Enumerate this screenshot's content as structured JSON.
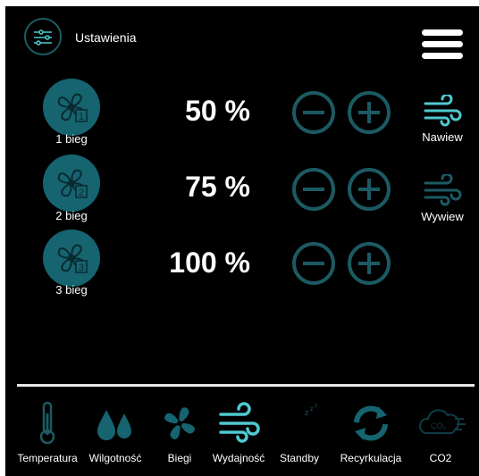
{
  "header": {
    "title": "Ustawienia",
    "settings_icon": "sliders-icon",
    "menu_icon": "hamburger-menu-icon"
  },
  "speeds": [
    {
      "label": "1 bieg",
      "value": "50 %",
      "badge": "1"
    },
    {
      "label": "2 bieg",
      "value": "75 %",
      "badge": "2"
    },
    {
      "label": "3 bieg",
      "value": "100 %",
      "badge": "3"
    }
  ],
  "airflow": {
    "supply": "Nawiew",
    "exhaust": "Wywiew"
  },
  "nav": [
    {
      "label": "Temperatura",
      "icon": "thermometer-icon"
    },
    {
      "label": "Wilgotność",
      "icon": "water-drops-icon"
    },
    {
      "label": "Biegi",
      "icon": "fan-icon"
    },
    {
      "label": "Wydajność",
      "icon": "wind-icon"
    },
    {
      "label": "Standby",
      "icon": "moon-sleep-icon"
    },
    {
      "label": "Recyrkulacja",
      "icon": "recycle-arrows-icon"
    },
    {
      "label": "CO2",
      "icon": "co2-cloud-icon"
    }
  ],
  "colors": {
    "accent": "#15646f",
    "accent_light": "#4ec9cf",
    "background": "#000000",
    "text": "#ffffff"
  }
}
